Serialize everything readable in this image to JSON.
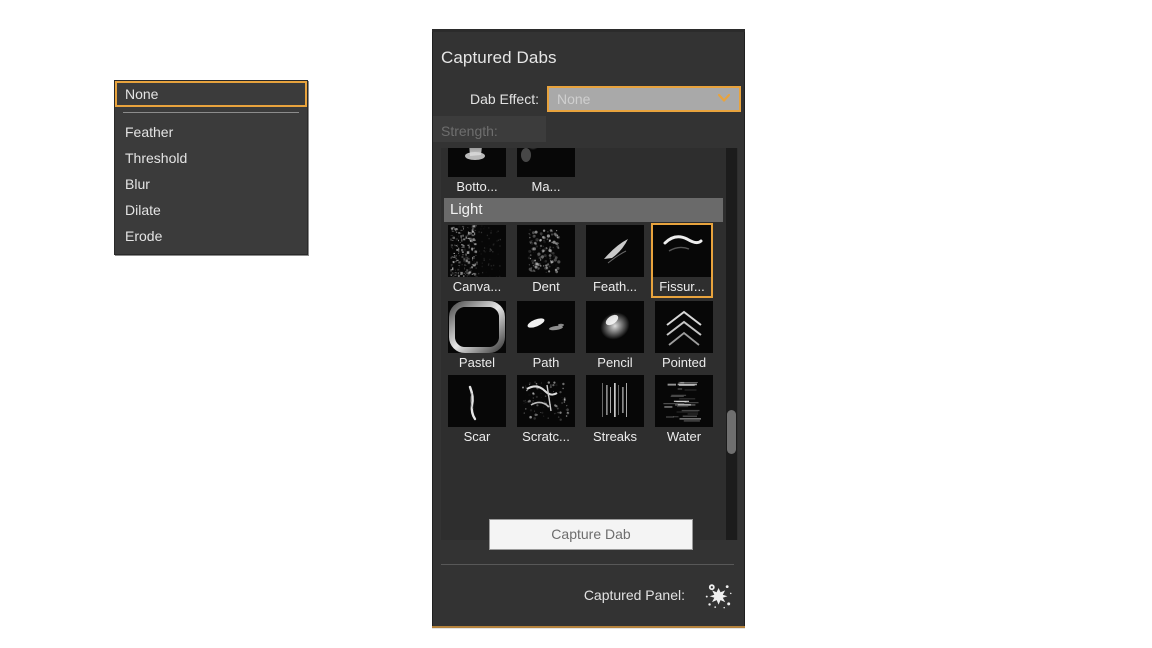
{
  "panel": {
    "title": "Captured Dabs",
    "colors": {
      "accent": "#e8a33d",
      "panel_bg": "#333333",
      "grid_bg": "#2e2e2e",
      "text": "#e6e6e6",
      "disabled_text": "#6e6e6e"
    }
  },
  "dab_effect": {
    "label": "Dab Effect:",
    "selected_value": "None",
    "chevron_icon": "chevron-down-icon",
    "options": [
      "None",
      "Feather",
      "Threshold",
      "Blur",
      "Dilate",
      "Erode"
    ],
    "dropdown_open": true,
    "highlighted_option": "None"
  },
  "strength": {
    "label": "Strength:",
    "enabled": false,
    "value": ""
  },
  "grid": {
    "rows": [
      {
        "type": "items",
        "items": [
          {
            "label": "Botto...",
            "art": "bottom",
            "selected": false
          },
          {
            "label": "Ma...",
            "art": "map",
            "selected": false
          }
        ]
      },
      {
        "type": "category",
        "label": "Light"
      },
      {
        "type": "items",
        "items": [
          {
            "label": "Canva...",
            "art": "canvas",
            "selected": false
          },
          {
            "label": "Dent",
            "art": "dent",
            "selected": false
          },
          {
            "label": "Feath...",
            "art": "feather",
            "selected": false
          },
          {
            "label": "Fissur...",
            "art": "fissure",
            "selected": true
          }
        ]
      },
      {
        "type": "items",
        "items": [
          {
            "label": "Pastel",
            "art": "pastel",
            "selected": false
          },
          {
            "label": "Path",
            "art": "path",
            "selected": false
          },
          {
            "label": "Pencil",
            "art": "pencil",
            "selected": false
          },
          {
            "label": "Pointed",
            "art": "pointed",
            "selected": false
          }
        ]
      },
      {
        "type": "items",
        "items": [
          {
            "label": "Scar",
            "art": "scar",
            "selected": false
          },
          {
            "label": "Scratc...",
            "art": "scratch",
            "selected": false
          },
          {
            "label": "Streaks",
            "art": "streaks",
            "selected": false
          },
          {
            "label": "Water",
            "art": "water",
            "selected": false
          }
        ]
      }
    ],
    "scrollbar": {
      "visible": true
    }
  },
  "capture_button": {
    "label": "Capture Dab"
  },
  "captured_panel": {
    "label": "Captured Panel:",
    "icon": "splat-icon"
  }
}
